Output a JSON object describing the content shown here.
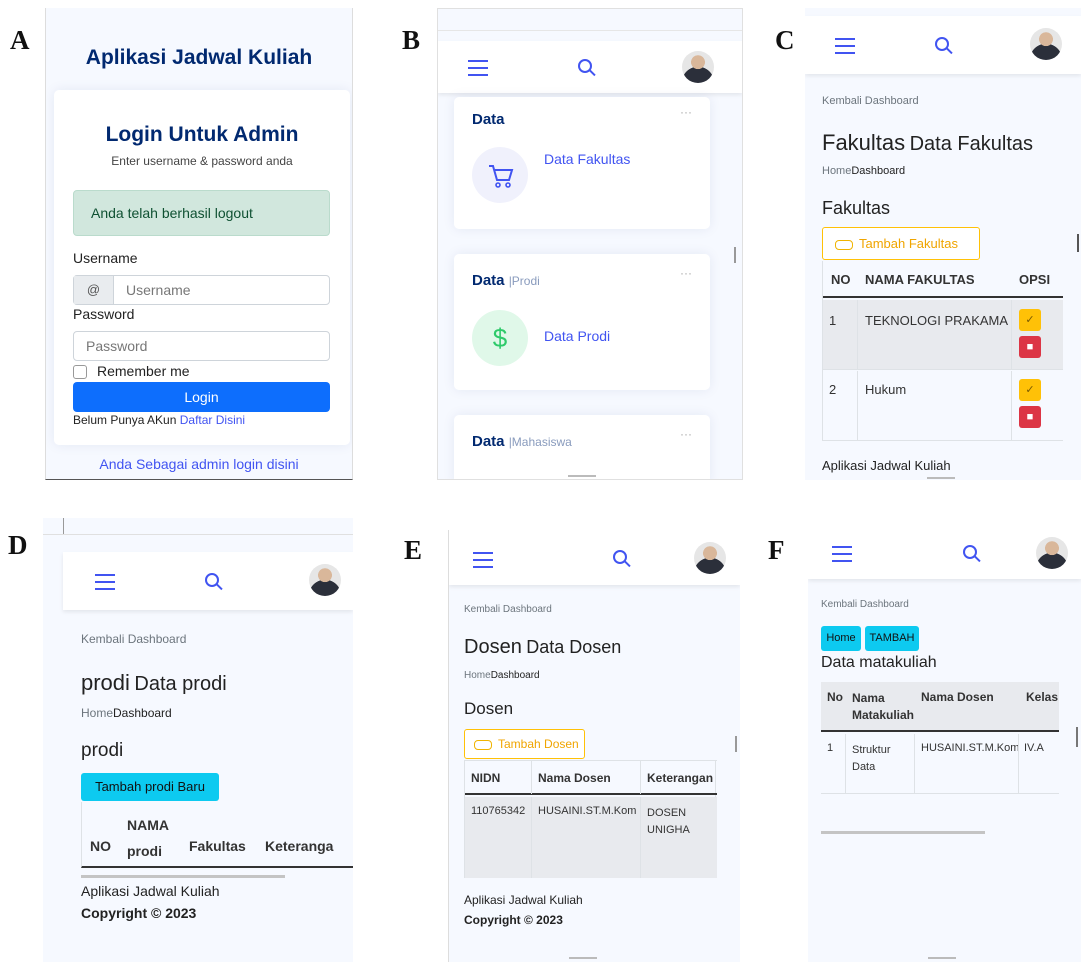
{
  "labels": [
    "A",
    "B",
    "C",
    "D",
    "E",
    "F"
  ],
  "panelA": {
    "app_title": "Aplikasi Jadwal Kuliah",
    "login_title": "Login Untuk Admin",
    "login_subtitle": "Enter username & password anda",
    "alert": "Anda telah berhasil logout",
    "username_label": "Username",
    "at_symbol": "@",
    "username_placeholder": "Username",
    "password_label": "Password",
    "password_placeholder": "Password",
    "remember": "Remember me",
    "login_button": "Login",
    "no_account": "Belum Punya AKun",
    "register_link": "Daftar Disini",
    "admin_link": "Anda Sebagai admin login disini"
  },
  "panelB": {
    "cards": [
      {
        "title": "Data",
        "sub": "",
        "link": "Data Fakultas",
        "icon": "cart-icon"
      },
      {
        "title": "Data",
        "sub": "|Prodi",
        "link": "Data Prodi",
        "icon": "dollar-icon"
      },
      {
        "title": "Data",
        "sub": "|Mahasiswa",
        "link": "",
        "icon": ""
      }
    ],
    "menu_dots": "···"
  },
  "panelC": {
    "back": "Kembali Dashboard",
    "page_title": "Fakultas",
    "page_sub": "Data Fakultas",
    "crumb_home": "Home",
    "crumb_dash": "Dashboard",
    "section": "Fakultas",
    "add_button": "Tambah Fakultas",
    "columns": [
      "NO",
      "NAMA FAKULTAS",
      "OPSI"
    ],
    "rows": [
      [
        "1",
        "TEKNOLOGI PRAKAMA"
      ],
      [
        "2",
        "Hukum"
      ]
    ],
    "footer": "Aplikasi Jadwal Kuliah"
  },
  "panelD": {
    "back": "Kembali Dashboard",
    "page_title": "prodi",
    "page_sub": "Data prodi",
    "crumb_home": "Home",
    "crumb_dash": "Dashboard",
    "section": "prodi",
    "add_button": "Tambah prodi Baru",
    "columns": [
      "NO",
      "NAMA prodi",
      "Fakultas",
      "Keteranga"
    ],
    "footer_app": "Aplikasi Jadwal Kuliah",
    "footer_copy": "Copyright © 2023"
  },
  "panelE": {
    "back": "Kembali Dashboard",
    "page_title": "Dosen",
    "page_sub": "Data Dosen",
    "crumb_home": "Home",
    "crumb_dash": "Dashboard",
    "section": "Dosen",
    "add_button": "Tambah Dosen",
    "columns": [
      "NIDN",
      "Nama Dosen",
      "Keterangan"
    ],
    "rows": [
      [
        "110765342",
        "HUSAINI.ST.M.Kom",
        "DOSEN UNIGHA"
      ]
    ],
    "footer_app": "Aplikasi Jadwal Kuliah",
    "footer_copy": "Copyright © 2023"
  },
  "panelF": {
    "back": "Kembali Dashboard",
    "btn_home": "Home",
    "btn_add": "TAMBAH",
    "page_title": "Data matakuliah",
    "columns": [
      "No",
      "Nama Matakuliah",
      "Nama Dosen",
      "Kelas"
    ],
    "rows": [
      [
        "1",
        "Struktur Data",
        "HUSAINI.ST.M.Kom",
        "IV.A"
      ]
    ]
  },
  "colors": {
    "primary": "#4154f1",
    "navy": "#012970",
    "warning": "#ffc107",
    "danger": "#dc3545",
    "info": "#0dcaf0",
    "success_bg": "#d1e7dd"
  }
}
